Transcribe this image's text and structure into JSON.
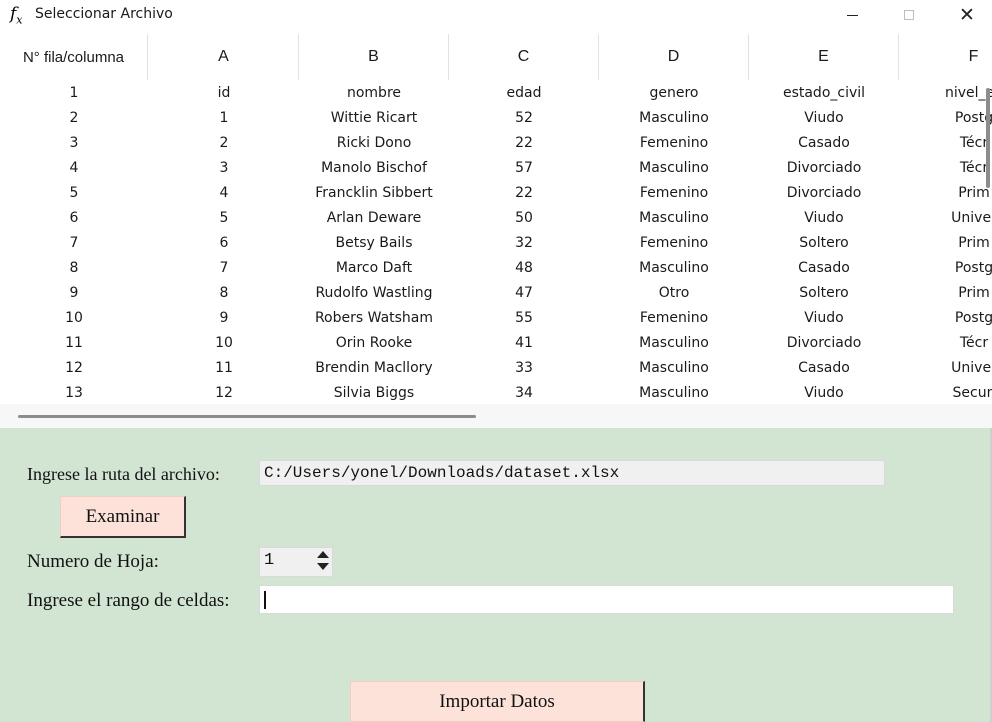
{
  "window": {
    "title": "Seleccionar Archivo",
    "icon": "fx-icon"
  },
  "table": {
    "row_header_label": "N° fila/columna",
    "column_letters": [
      "A",
      "B",
      "C",
      "D",
      "E",
      "F"
    ],
    "rows": [
      [
        "1",
        "id",
        "nombre",
        "edad",
        "genero",
        "estado_civil",
        "nivel_ed"
      ],
      [
        "2",
        "1",
        "Wittie Ricart",
        "52",
        "Masculino",
        "Viudo",
        "Postg"
      ],
      [
        "3",
        "2",
        "Ricki Dono",
        "22",
        "Femenino",
        "Casado",
        "Técr"
      ],
      [
        "4",
        "3",
        "Manolo Bischof",
        "57",
        "Masculino",
        "Divorciado",
        "Técr"
      ],
      [
        "5",
        "4",
        "Francklin Sibbert",
        "22",
        "Femenino",
        "Divorciado",
        "Prim"
      ],
      [
        "6",
        "5",
        "Arlan Deware",
        "50",
        "Masculino",
        "Viudo",
        "Univer"
      ],
      [
        "7",
        "6",
        "Betsy Bails",
        "32",
        "Femenino",
        "Soltero",
        "Prim"
      ],
      [
        "8",
        "7",
        "Marco Daft",
        "48",
        "Masculino",
        "Casado",
        "Postg"
      ],
      [
        "9",
        "8",
        "Rudolfo Wastling",
        "47",
        "Otro",
        "Soltero",
        "Prim"
      ],
      [
        "10",
        "9",
        "Robers Watsham",
        "55",
        "Femenino",
        "Viudo",
        "Postg"
      ],
      [
        "11",
        "10",
        "Orin Rooke",
        "41",
        "Masculino",
        "Divorciado",
        "Técr"
      ],
      [
        "12",
        "11",
        "Brendin Macllory",
        "33",
        "Masculino",
        "Casado",
        "Univer"
      ],
      [
        "13",
        "12",
        "Silvia Biggs",
        "34",
        "Masculino",
        "Viudo",
        "Secun"
      ]
    ]
  },
  "form": {
    "path_label": "Ingrese la ruta del archivo:",
    "path_value": "C:/Users/yonel/Downloads/dataset.xlsx",
    "browse_label": "Examinar",
    "sheet_label": "Numero de Hoja:",
    "sheet_value": "1",
    "range_label": "Ingrese el rango de celdas:",
    "range_value": "",
    "import_label": "Importar Datos"
  },
  "colors": {
    "panel_bg": "#d2e5d3",
    "button_bg": "#fde2da"
  }
}
